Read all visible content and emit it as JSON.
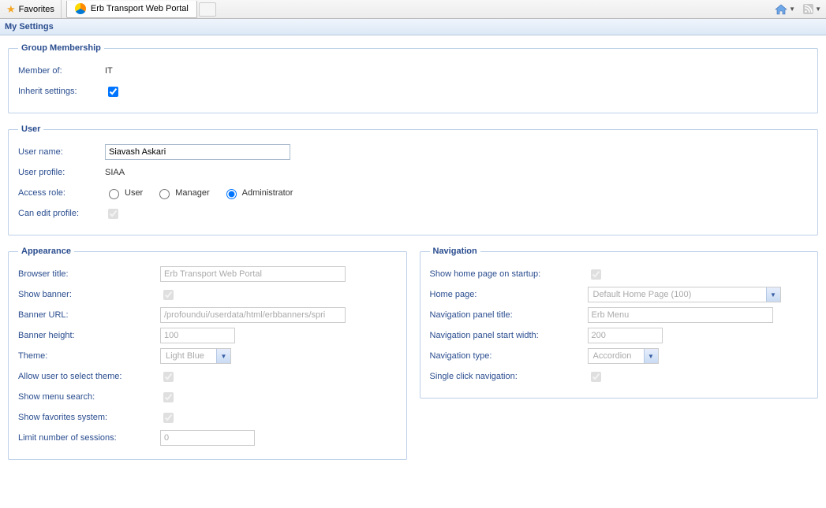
{
  "browser": {
    "favorites_label": "Favorites",
    "tab_title": "Erb Transport Web Portal"
  },
  "page_title": "My Settings",
  "group_membership": {
    "legend": "Group Membership",
    "member_of_label": "Member of:",
    "member_of_value": "IT",
    "inherit_label": "Inherit settings:",
    "inherit_checked": true
  },
  "user": {
    "legend": "User",
    "username_label": "User name:",
    "username_value": "Siavash Askari",
    "profile_label": "User profile:",
    "profile_value": "SIAA",
    "access_role_label": "Access role:",
    "roles": {
      "user": "User",
      "manager": "Manager",
      "admin": "Administrator"
    },
    "selected_role": "Administrator",
    "can_edit_label": "Can edit profile:",
    "can_edit_checked": true
  },
  "appearance": {
    "legend": "Appearance",
    "browser_title_label": "Browser title:",
    "browser_title_value": "Erb Transport Web Portal",
    "show_banner_label": "Show banner:",
    "show_banner_checked": true,
    "banner_url_label": "Banner URL:",
    "banner_url_value": "/profoundui/userdata/html/erbbanners/spri",
    "banner_height_label": "Banner height:",
    "banner_height_value": "100",
    "theme_label": "Theme:",
    "theme_value": "Light Blue",
    "allow_theme_label": "Allow user to select theme:",
    "allow_theme_checked": true,
    "show_search_label": "Show menu search:",
    "show_search_checked": true,
    "show_fav_label": "Show favorites system:",
    "show_fav_checked": true,
    "limit_sessions_label": "Limit number of sessions:",
    "limit_sessions_value": "0"
  },
  "navigation": {
    "legend": "Navigation",
    "show_home_label": "Show home page on startup:",
    "show_home_checked": true,
    "home_page_label": "Home page:",
    "home_page_value": "Default Home Page (100)",
    "panel_title_label": "Navigation panel title:",
    "panel_title_value": "Erb Menu",
    "start_width_label": "Navigation panel start width:",
    "start_width_value": "200",
    "nav_type_label": "Navigation type:",
    "nav_type_value": "Accordion",
    "single_click_label": "Single click navigation:",
    "single_click_checked": true
  }
}
